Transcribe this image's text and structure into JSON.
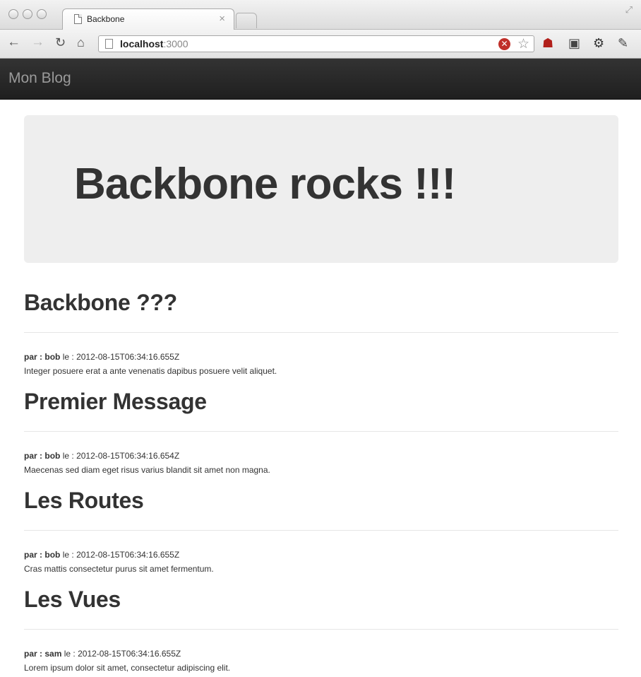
{
  "browser": {
    "tab_title": "Backbone",
    "tab_close": "×",
    "url_host": "localhost",
    "url_port": ":3000"
  },
  "navbar": {
    "brand": "Mon Blog"
  },
  "hero": {
    "title": "Backbone rocks !!!"
  },
  "posts": [
    {
      "title": "Backbone ???",
      "by_label": "par :",
      "author": "bob",
      "date_label": "le :",
      "date": "2012-08-15T06:34:16.655Z",
      "message": "Integer posuere erat a ante venenatis dapibus posuere velit aliquet."
    },
    {
      "title": "Premier Message",
      "by_label": "par :",
      "author": "bob",
      "date_label": "le :",
      "date": "2012-08-15T06:34:16.654Z",
      "message": "Maecenas sed diam eget risus varius blandit sit amet non magna."
    },
    {
      "title": "Les Routes",
      "by_label": "par :",
      "author": "bob",
      "date_label": "le :",
      "date": "2012-08-15T06:34:16.655Z",
      "message": "Cras mattis consectetur purus sit amet fermentum."
    },
    {
      "title": "Les Vues",
      "by_label": "par :",
      "author": "sam",
      "date_label": "le :",
      "date": "2012-08-15T06:34:16.655Z",
      "message": "Lorem ipsum dolor sit amet, consectetur adipiscing elit."
    }
  ]
}
